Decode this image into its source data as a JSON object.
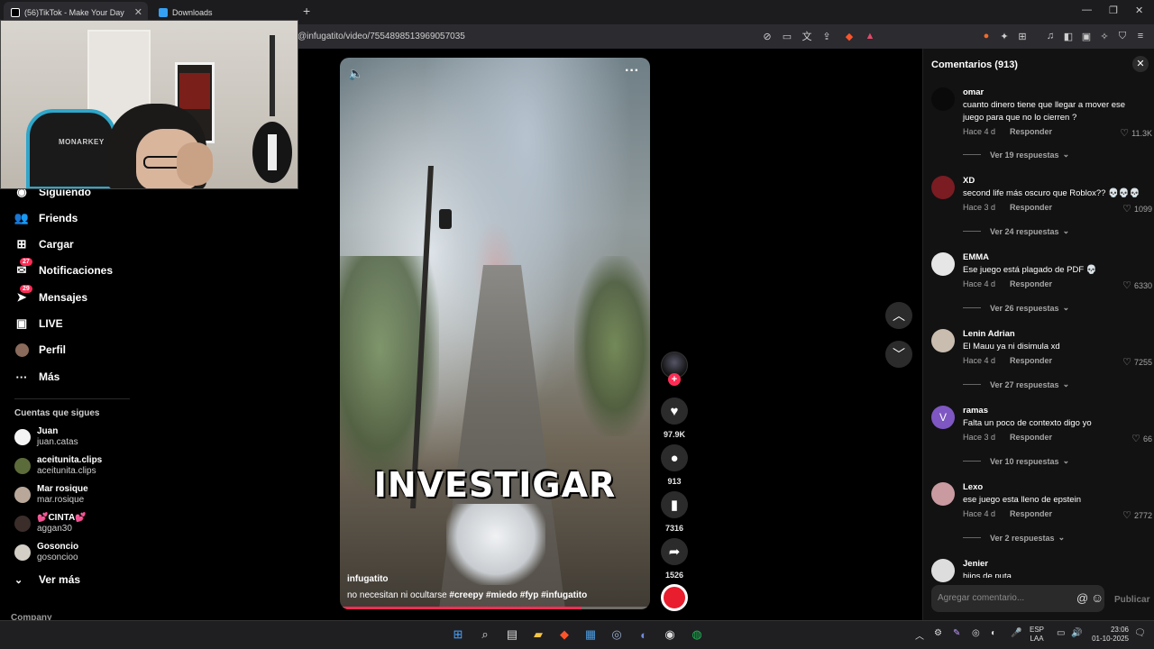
{
  "browser": {
    "tabs": [
      {
        "title": "(56)TikTok - Make Your Day",
        "active": true
      },
      {
        "title": "Downloads",
        "active": false
      }
    ],
    "url": "@infugatito/video/7554898513969057035"
  },
  "sidebar": {
    "nav": [
      {
        "label": "Siguiendo",
        "icon": "following-icon"
      },
      {
        "label": "Friends",
        "icon": "friends-icon"
      },
      {
        "label": "Cargar",
        "icon": "upload-icon"
      },
      {
        "label": "Notificaciones",
        "icon": "notifications-icon",
        "badge": "27"
      },
      {
        "label": "Mensajes",
        "icon": "messages-icon",
        "badge": "29"
      },
      {
        "label": "LIVE",
        "icon": "live-icon"
      },
      {
        "label": "Perfil",
        "icon": "profile-icon"
      },
      {
        "label": "Más",
        "icon": "more-icon"
      }
    ],
    "following_title": "Cuentas que sigues",
    "accounts": [
      {
        "name": "Juan",
        "handle": "juan.catas"
      },
      {
        "name": "aceitunita.clips",
        "handle": "aceitunita.clips"
      },
      {
        "name": "Mar rosique",
        "handle": "mar.rosique"
      },
      {
        "name": "💕CINTA💕",
        "handle": "aggan30"
      },
      {
        "name": "Gosoncio",
        "handle": "gosoncioo"
      }
    ],
    "see_more": "Ver más",
    "company": "Company"
  },
  "video": {
    "overlay_text": "INVESTIGAR",
    "author": "infugatito",
    "description": "no necesitan ni ocultarse",
    "hashtags": "#creepy #miedo #fyp #infugatito",
    "progress": 0.78
  },
  "actions": {
    "likes": "97.9K",
    "comments": "913",
    "saves": "7316",
    "shares": "1526"
  },
  "comments_panel": {
    "title": "Comentarios (913)",
    "input_placeholder": "Agregar comentario...",
    "publish_label": "Publicar",
    "reply_label": "Responder",
    "items": [
      {
        "user": "omar",
        "text": "cuanto dinero tiene que llegar a mover ese juego para que no lo cierren ?",
        "time": "Hace 4 d",
        "likes": "11.3K",
        "replies": "Ver 19 respuestas"
      },
      {
        "user": "XD",
        "text": "second life más oscuro que Roblox?? 💀💀💀",
        "time": "Hace 3 d",
        "likes": "1099",
        "replies": "Ver 24 respuestas"
      },
      {
        "user": "EMMA",
        "text": "Ese juego está plagado de PDF 💀",
        "time": "Hace 4 d",
        "likes": "6330",
        "replies": "Ver 26 respuestas"
      },
      {
        "user": "Lenin Adrian",
        "text": "El Mauu ya ni disimula xd",
        "time": "Hace 4 d",
        "likes": "7255",
        "replies": "Ver 27 respuestas"
      },
      {
        "user": "ramas",
        "text": "Falta un poco de contexto digo yo",
        "time": "Hace 3 d",
        "likes": "66",
        "replies": "Ver 10 respuestas"
      },
      {
        "user": "Lexo",
        "text": "ese juego esta lleno de epstein",
        "time": "Hace 4 d",
        "likes": "2772",
        "replies": "Ver 2 respuestas"
      },
      {
        "user": "Jenier",
        "text": "hijos de puta",
        "time": "",
        "likes": "",
        "replies": ""
      }
    ]
  },
  "taskbar": {
    "lang_1": "ESP",
    "lang_2": "LAA",
    "time": "23:06",
    "date": "01-10-2025"
  },
  "colors": {
    "accent": "#fe2c55",
    "panel_bg": "#121212"
  }
}
